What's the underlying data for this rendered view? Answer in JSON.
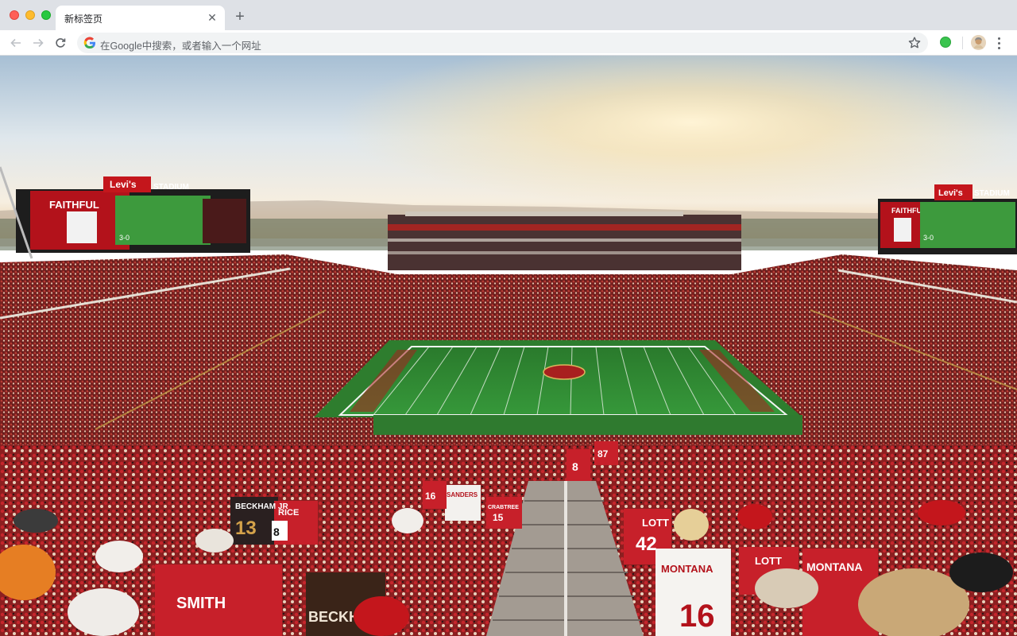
{
  "browser": {
    "tab": {
      "title": "新标签页",
      "close_icon": "close-icon"
    },
    "new_tab_icon": "plus-icon",
    "toolbar": {
      "back_icon": "back-arrow-icon",
      "forward_icon": "forward-arrow-icon",
      "reload_icon": "reload-icon",
      "omnibox_placeholder": "在Google中搜索，或者输入一个网址",
      "bookmark_icon": "star-icon",
      "menu_icon": "kebab-menu-icon"
    }
  },
  "background": {
    "scene": "stadium",
    "scoreboard_left": {
      "brand": "Levi's",
      "suffix": "STADIUM",
      "panel_text": "FAITHFUL",
      "score": "3-0"
    },
    "scoreboard_right": {
      "brand": "Levi's",
      "suffix": "STADIUM",
      "panel_text": "FAITHFUL",
      "score": "3-0"
    },
    "jersey_names": [
      "SMITH",
      "BECKHAM",
      "LOTT",
      "MONTANA",
      "MONTANA",
      "LOTT",
      "RICE",
      "BECKHAM JR",
      "SANDERS",
      "CRABTREE"
    ],
    "jersey_numbers": [
      "16",
      "13",
      "8",
      "87",
      "42",
      "15",
      "16",
      "8"
    ],
    "colors": {
      "accent_red": "#b3121b",
      "field_green": "#2e8a31",
      "sky_top": "#9fb8d0",
      "sun": "#ffe7b0"
    }
  }
}
